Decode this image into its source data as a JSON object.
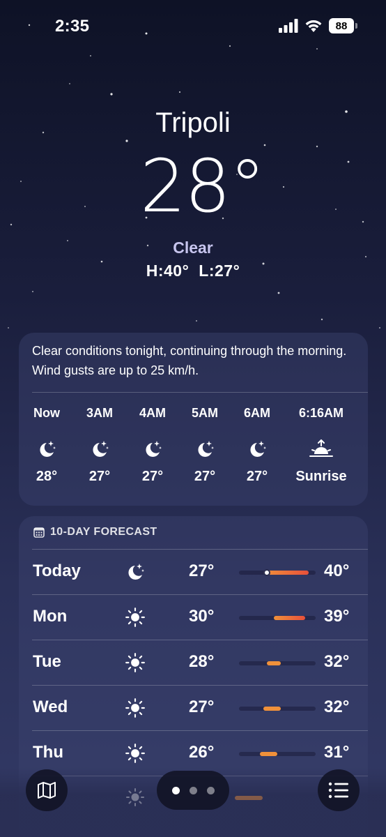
{
  "status": {
    "time": "2:35",
    "battery": "88"
  },
  "location": {
    "city": "Tripoli",
    "temperature": "28°",
    "condition": "Clear",
    "high": "H:40°",
    "low": "L:27°"
  },
  "hourly": {
    "summary": "Clear conditions tonight, continuing through the morning. Wind gusts are up to 25 km/h.",
    "items": [
      {
        "time": "Now",
        "icon": "moon-stars-icon",
        "value": "28°"
      },
      {
        "time": "3AM",
        "icon": "moon-stars-icon",
        "value": "27°"
      },
      {
        "time": "4AM",
        "icon": "moon-stars-icon",
        "value": "27°"
      },
      {
        "time": "5AM",
        "icon": "moon-stars-icon",
        "value": "27°"
      },
      {
        "time": "6AM",
        "icon": "moon-stars-icon",
        "value": "27°"
      },
      {
        "time": "6:16AM",
        "icon": "sunrise-icon",
        "value": "Sunrise"
      }
    ]
  },
  "forecast": {
    "header": "10-DAY FORECAST",
    "range_min": 20,
    "range_max": 42,
    "days": [
      {
        "day": "Today",
        "icon": "moon-stars-icon",
        "low": "27°",
        "high": "40°",
        "low_value": 27,
        "high_value": 40,
        "current": 28
      },
      {
        "day": "Mon",
        "icon": "sun-icon",
        "low": "30°",
        "high": "39°",
        "low_value": 30,
        "high_value": 39
      },
      {
        "day": "Tue",
        "icon": "sun-icon",
        "low": "28°",
        "high": "32°",
        "low_value": 28,
        "high_value": 32
      },
      {
        "day": "Wed",
        "icon": "sun-icon",
        "low": "27°",
        "high": "32°",
        "low_value": 27,
        "high_value": 32
      },
      {
        "day": "Thu",
        "icon": "sun-icon",
        "low": "26°",
        "high": "31°",
        "low_value": 26,
        "high_value": 31
      }
    ]
  },
  "colors": {
    "hot": "#e8503a",
    "warm": "#f0913a",
    "accent_text": "#c7c5ee"
  },
  "navigation": {
    "map_icon": "map-icon",
    "list_icon": "list-icon",
    "pages": 3,
    "active_page": 1
  }
}
